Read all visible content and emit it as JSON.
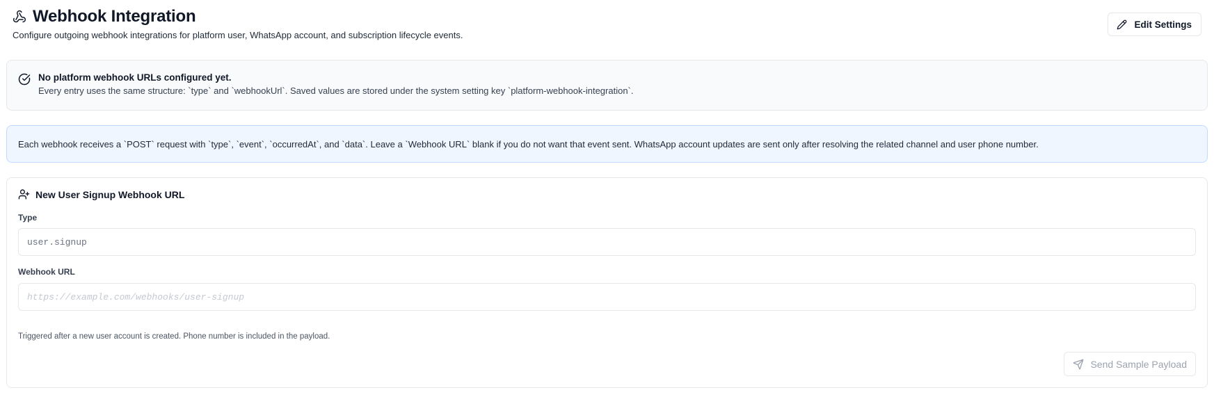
{
  "header": {
    "title": "Webhook Integration",
    "subtitle": "Configure outgoing webhook integrations for platform user, WhatsApp account, and subscription lifecycle events.",
    "title_icon": "webhook-icon",
    "edit_button_label": "Edit Settings",
    "edit_button_icon": "pencil-icon"
  },
  "status_alert": {
    "icon": "check-circle-icon",
    "title": "No platform webhook URLs configured yet.",
    "description": "Every entry uses the same structure: `type` and `webhookUrl`. Saved values are stored under the system setting key `platform-webhook-integration`."
  },
  "info_alert": {
    "text": "Each webhook receives a `POST` request with `type`, `event`, `occurredAt`, and `data`. Leave a `Webhook URL` blank if you do not want that event sent. WhatsApp account updates are sent only after resolving the related channel and user phone number."
  },
  "signup_card": {
    "icon": "user-plus-icon",
    "title": "New User Signup Webhook URL",
    "type_label": "Type",
    "type_value": "user.signup",
    "url_label": "Webhook URL",
    "url_value": "",
    "url_placeholder": "https://example.com/webhooks/user-signup",
    "help_text": "Triggered after a new user account is created. Phone number is included in the payload.",
    "send_button_label": "Send Sample Payload",
    "send_button_icon": "send-icon",
    "send_button_disabled": true
  },
  "colors": {
    "info_bg": "#eff6ff",
    "info_border": "#bfdbfe",
    "status_bg": "#f8fafc",
    "border": "#e5e7eb"
  }
}
